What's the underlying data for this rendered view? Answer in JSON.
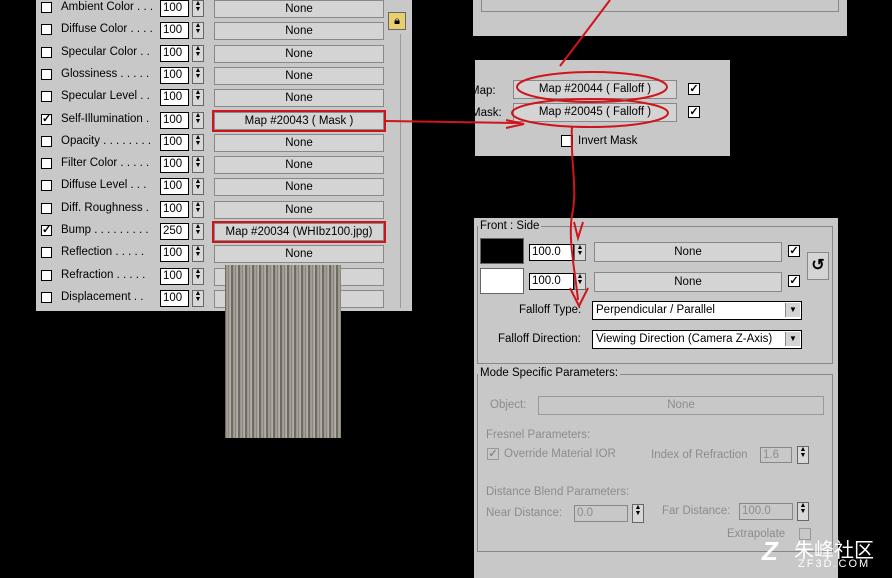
{
  "material_maps": {
    "rows": [
      {
        "label": "Ambient Color . . .",
        "checked": false,
        "amount": "100",
        "map": "None",
        "name": "ambient-color"
      },
      {
        "label": "Diffuse Color . . . .",
        "checked": false,
        "amount": "100",
        "map": "None",
        "name": "diffuse-color"
      },
      {
        "label": "Specular Color . .",
        "checked": false,
        "amount": "100",
        "map": "None",
        "name": "specular-color"
      },
      {
        "label": "Glossiness . . . . .",
        "checked": false,
        "amount": "100",
        "map": "None",
        "name": "glossiness"
      },
      {
        "label": "Specular Level . .",
        "checked": false,
        "amount": "100",
        "map": "None",
        "name": "specular-level"
      },
      {
        "label": "Self-Illumination .",
        "checked": true,
        "amount": "100",
        "map": "Map #20043  ( Mask )",
        "name": "self-illumination"
      },
      {
        "label": "Opacity . . . . . . . .",
        "checked": false,
        "amount": "100",
        "map": "None",
        "name": "opacity"
      },
      {
        "label": "Filter Color . . . . .",
        "checked": false,
        "amount": "100",
        "map": "None",
        "name": "filter-color"
      },
      {
        "label": "Diffuse Level . . .",
        "checked": false,
        "amount": "100",
        "map": "None",
        "name": "diffuse-level"
      },
      {
        "label": "Diff. Roughness .",
        "checked": false,
        "amount": "100",
        "map": "None",
        "name": "diff-roughness"
      },
      {
        "label": "Bump . . . . . . . . .",
        "checked": true,
        "amount": "250",
        "map": "Map #20034 (WHIbz100.jpg)",
        "name": "bump"
      },
      {
        "label": "Reflection . . . . .",
        "checked": false,
        "amount": "100",
        "map": "None",
        "name": "reflection"
      },
      {
        "label": "Refraction . . . . .",
        "checked": false,
        "amount": "100",
        "map": "None",
        "name": "refraction"
      },
      {
        "label": "Displacement . .",
        "checked": false,
        "amount": "100",
        "map": "None",
        "name": "displacement"
      }
    ]
  },
  "mask_panel": {
    "map_label": "Map:",
    "mask_label": "Mask:",
    "map_button": "Map #20044  ( Falloff )",
    "mask_button": "Map #20045  ( Falloff )",
    "invert_label": "Invert Mask"
  },
  "falloff": {
    "front_side_title": "Front : Side",
    "front_amount": "100.0",
    "side_amount": "100.0",
    "front_map": "None",
    "side_map": "None",
    "falloff_type_label": "Falloff Type:",
    "falloff_type_value": "Perpendicular / Parallel",
    "falloff_direction_label": "Falloff Direction:",
    "falloff_direction_value": "Viewing Direction (Camera Z-Axis)",
    "mode_title": "Mode Specific Parameters:",
    "object_label": "Object:",
    "object_value": "None",
    "fresnel_title": "Fresnel Parameters:",
    "override_ior_label": "Override Material IOR",
    "ior_label": "Index of Refraction",
    "ior_value": "1.6",
    "distance_title": "Distance Blend Parameters:",
    "near_label": "Near Distance:",
    "near_value": "0.0",
    "far_label": "Far Distance:",
    "far_value": "100.0",
    "extrapolate_label": "Extrapolate"
  },
  "watermark": {
    "text": "朱峰社区",
    "sub": "ZF3D.COM"
  },
  "colors": {
    "annotation": "#d0141c",
    "panel": "#c8c8c8",
    "background": "#000000"
  }
}
